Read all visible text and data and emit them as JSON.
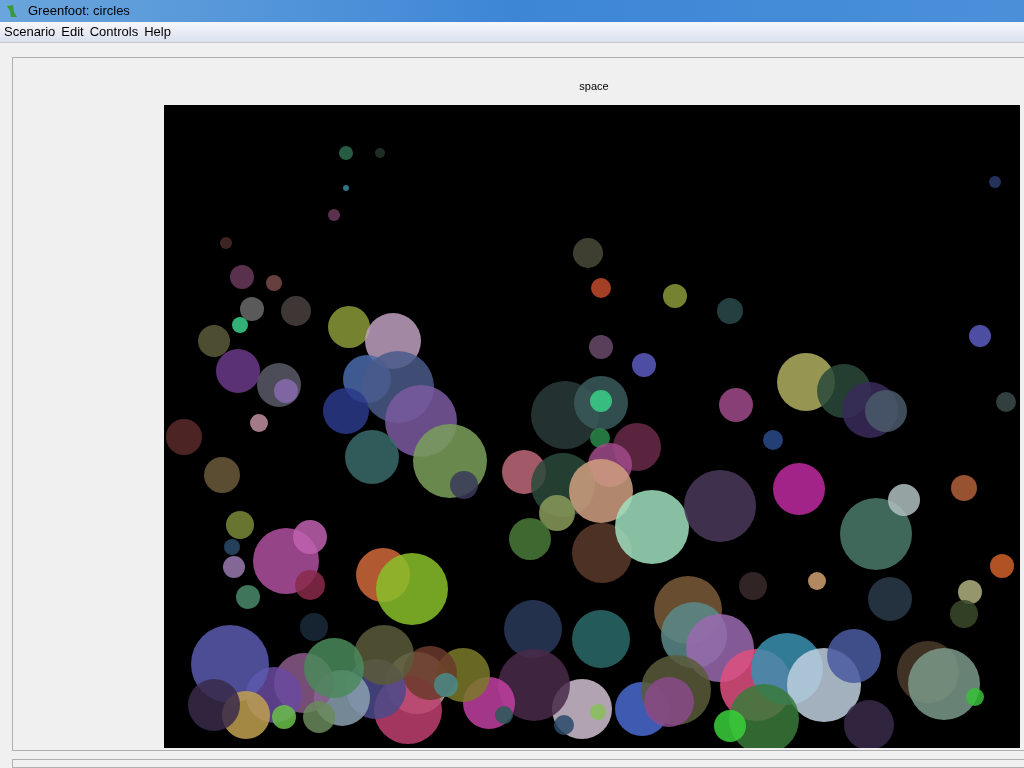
{
  "window": {
    "title": "Greenfoot: circles"
  },
  "menu": [
    "Scenario",
    "Edit",
    "Controls",
    "Help"
  ],
  "world": {
    "title": "space"
  }
}
